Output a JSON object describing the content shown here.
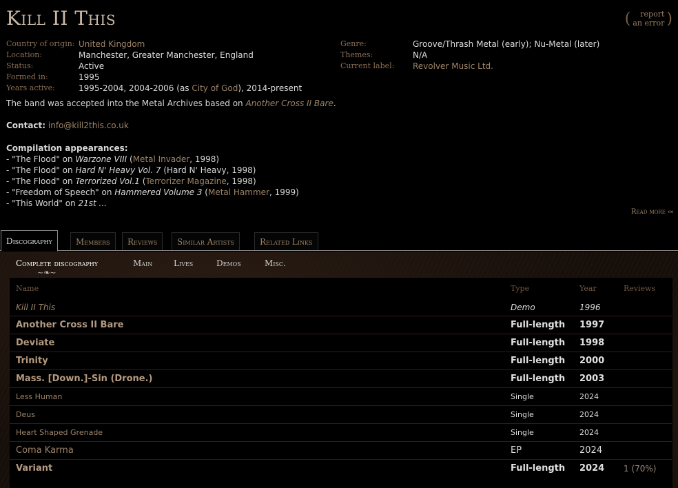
{
  "band": {
    "name": "Kill II This",
    "report_line1": "report",
    "report_line2": "an error"
  },
  "stats_left": [
    {
      "label": "Country of origin:",
      "value": "United Kingdom",
      "link": true
    },
    {
      "label": "Location:",
      "value": "Manchester, Greater Manchester, England"
    },
    {
      "label": "Status:",
      "value": "Active",
      "status": true
    },
    {
      "label": "Formed in:",
      "value": "1995"
    },
    {
      "label": "Years active:",
      "value_pre": "1995-2004, 2004-2006 (as ",
      "value_link": "City of God",
      "value_post": "), 2014-present"
    }
  ],
  "stats_right": [
    {
      "label": "Genre:",
      "value": "Groove/Thrash Metal (early); Nu-Metal (later)"
    },
    {
      "label": "Themes:",
      "value": "N/A"
    },
    {
      "label": "Current label:",
      "value": "Revolver Music Ltd.",
      "link": true
    }
  ],
  "accepted": {
    "text": "The band was accepted into the Metal Archives based on ",
    "album": "Another Cross II Bare",
    "end": "."
  },
  "contact": {
    "label": "Contact:",
    "email": "info@kill2this.co.uk"
  },
  "compilations": {
    "title": "Compilation appearances:",
    "items": [
      {
        "pre": "- \"The Flood\" on ",
        "album": "Warzone VIII",
        "mid": " (",
        "label": "Metal Invader",
        "post": ", 1998)"
      },
      {
        "pre": "- \"The Flood\" on ",
        "album": "Hard N' Heavy Vol. 7",
        "mid": " (Hard N' Heavy, 1998)",
        "label": "",
        "post": ""
      },
      {
        "pre": "- \"The Flood\" on ",
        "album": "Terrorized Vol.1",
        "mid": " (",
        "label": "Terrorizer Magazine",
        "post": ", 1998)"
      },
      {
        "pre": "- \"Freedom of Speech\" on ",
        "album": "Hammered Volume 3",
        "mid": " (",
        "label": "Metal Hammer",
        "post": ", 1999)"
      },
      {
        "pre": "- \"This World\" on ",
        "album": "21st ...",
        "mid": "",
        "label": "",
        "post": ""
      }
    ]
  },
  "read_more": "Read more",
  "tabs": [
    "Discography",
    "Members",
    "Reviews",
    "Similar Artists",
    "Related Links"
  ],
  "subtabs": [
    "Complete discography",
    "Main",
    "Lives",
    "Demos",
    "Misc."
  ],
  "table": {
    "headers": {
      "name": "Name",
      "type": "Type",
      "year": "Year",
      "reviews": "Reviews"
    },
    "rows": [
      {
        "name": "Kill II This",
        "type": "Demo",
        "year": "1996",
        "reviews": "",
        "kind": "demo"
      },
      {
        "name": "Another Cross II Bare",
        "type": "Full-length",
        "year": "1997",
        "reviews": "",
        "kind": "full"
      },
      {
        "name": "Deviate",
        "type": "Full-length",
        "year": "1998",
        "reviews": "",
        "kind": "full"
      },
      {
        "name": "Trinity",
        "type": "Full-length",
        "year": "2000",
        "reviews": "",
        "kind": "full"
      },
      {
        "name": "Mass. [Down.]-Sin (Drone.)",
        "type": "Full-length",
        "year": "2003",
        "reviews": "",
        "kind": "full"
      },
      {
        "name": "Less Human",
        "type": "Single",
        "year": "2024",
        "reviews": "",
        "kind": "single"
      },
      {
        "name": "Deus",
        "type": "Single",
        "year": "2024",
        "reviews": "",
        "kind": "single"
      },
      {
        "name": "Heart Shaped Grenade",
        "type": "Single",
        "year": "2024",
        "reviews": "",
        "kind": "single"
      },
      {
        "name": "Coma Karma",
        "type": "EP",
        "year": "2024",
        "reviews": "",
        "kind": "ep"
      },
      {
        "name": "Variant",
        "type": "Full-length",
        "year": "2024",
        "reviews": "1 (70%)",
        "kind": "full"
      }
    ]
  }
}
